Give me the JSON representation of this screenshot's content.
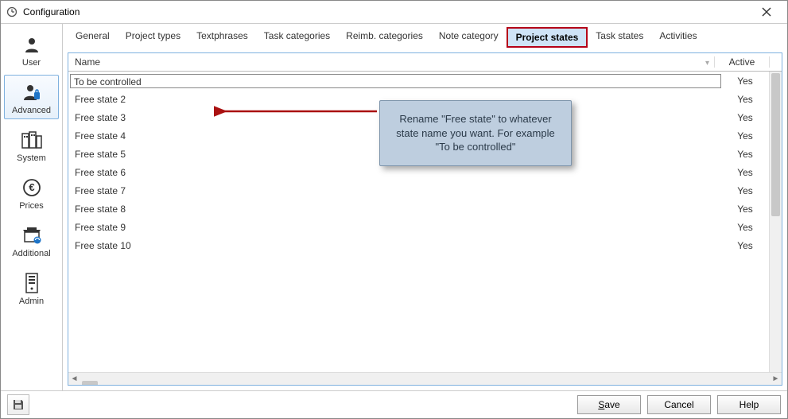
{
  "window": {
    "title": "Configuration"
  },
  "sidebar": {
    "items": [
      {
        "id": "user",
        "label": "User"
      },
      {
        "id": "advanced",
        "label": "Advanced"
      },
      {
        "id": "system",
        "label": "System"
      },
      {
        "id": "prices",
        "label": "Prices"
      },
      {
        "id": "additional",
        "label": "Additional"
      },
      {
        "id": "admin",
        "label": "Admin"
      }
    ],
    "selected_index": 1
  },
  "tabs": {
    "items": [
      "General",
      "Project types",
      "Textphrases",
      "Task categories",
      "Reimb. categories",
      "Note category",
      "Project states",
      "Task states",
      "Activities"
    ],
    "active_index": 6
  },
  "grid": {
    "headers": {
      "name": "Name",
      "active": "Active"
    },
    "rows": [
      {
        "name": "To be controlled",
        "active": "Yes",
        "editing": true
      },
      {
        "name": "Free state 2",
        "active": "Yes"
      },
      {
        "name": "Free state 3",
        "active": "Yes"
      },
      {
        "name": "Free state 4",
        "active": "Yes"
      },
      {
        "name": "Free state 5",
        "active": "Yes"
      },
      {
        "name": "Free state 6",
        "active": "Yes"
      },
      {
        "name": "Free state 7",
        "active": "Yes"
      },
      {
        "name": "Free state 8",
        "active": "Yes"
      },
      {
        "name": "Free state 9",
        "active": "Yes"
      },
      {
        "name": "Free state 10",
        "active": "Yes"
      }
    ]
  },
  "footer": {
    "save_label": "Save",
    "cancel_label": "Cancel",
    "help_label": "Help"
  },
  "annotation": {
    "text": "Rename \"Free state\" to whatever state name you want. For example \"To be controlled\""
  }
}
